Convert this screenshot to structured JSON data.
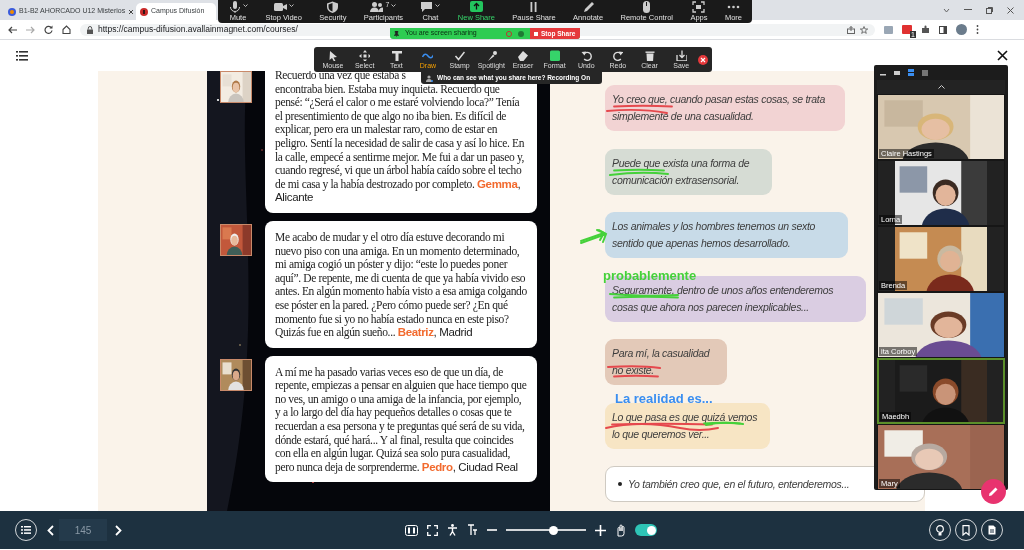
{
  "browser": {
    "tabs": [
      {
        "title": "B1-B2 AHORCADO U12 Misterios",
        "selected": false
      },
      {
        "title": "Campus Difusión",
        "selected": true
      }
    ],
    "url": "https://campus-difusion.avallainmagnet.com/courses/",
    "extension_badge": "1"
  },
  "meeting_toolbar": {
    "buttons": [
      {
        "label": "Mute",
        "kind": "mic"
      },
      {
        "label": "Stop Video",
        "kind": "video"
      },
      {
        "label": "Security",
        "kind": "shield"
      },
      {
        "label": "Participants",
        "kind": "participants",
        "count": "7"
      },
      {
        "label": "Chat",
        "kind": "chat"
      },
      {
        "label": "New Share",
        "kind": "share"
      },
      {
        "label": "Pause Share",
        "kind": "pause"
      },
      {
        "label": "Annotate",
        "kind": "annotate"
      },
      {
        "label": "Remote Control",
        "kind": "remote"
      },
      {
        "label": "Apps",
        "kind": "apps"
      },
      {
        "label": "More",
        "kind": "more"
      }
    ]
  },
  "sharing_banner": {
    "text": "You are screen sharing",
    "stop": "Stop Share"
  },
  "annotation_toolbar": {
    "tools": [
      {
        "label": "Mouse",
        "kind": "mouse",
        "selected": false
      },
      {
        "label": "Select",
        "kind": "select",
        "selected": false
      },
      {
        "label": "Text",
        "kind": "text",
        "selected": false
      },
      {
        "label": "Draw",
        "kind": "draw",
        "selected": true
      },
      {
        "label": "Stamp",
        "kind": "stamp",
        "selected": false
      },
      {
        "label": "Spotlight",
        "kind": "spotlight",
        "selected": false
      },
      {
        "label": "Eraser",
        "kind": "eraser",
        "selected": false
      },
      {
        "label": "Format",
        "kind": "format",
        "selected": false
      },
      {
        "label": "Undo",
        "kind": "undo",
        "selected": false
      },
      {
        "label": "Redo",
        "kind": "redo",
        "selected": false
      },
      {
        "label": "Clear",
        "kind": "clear",
        "selected": false
      },
      {
        "label": "Save",
        "kind": "save",
        "selected": false
      }
    ],
    "notice": "Who can see what you share here? Recording On"
  },
  "testimonials": [
    {
      "first_line": "Recuerdo una vez que estaba s",
      "text": "encontraba bien. Estaba muy inquieta. Recuerdo que pensé: “¿Será el calor o me estaré volviendo loca?” Tenía el presentimiento de que algo no iba bien. Es difícil de explicar, pero era un malestar raro, como de estar en peligro. Sentí la necesidad de salir de casa y así lo hice. En la calle, empecé a sentirme mejor. Me fui a dar un paseo y, cuando regresé, vi que un árbol había caído sobre el techo de mi casa y la había destrozado por completo.",
      "signature": "**Gemma**, Alicante"
    },
    {
      "text": "Me acabo de mudar y el otro día estuve decorando mi nuevo piso con una amiga. En un momento determinado, mi amiga cogió un póster y dijo: “este lo puedes poner aquí”. De repente, me di cuenta de que ya había vivido eso antes. En algún momento había visto a esa amiga colgando ese póster en la pared. ¿Pero cómo puede ser? ¿En qué momento fue si yo no había estado nunca en este piso? Quizás fue en algún sueño...",
      "signature": "**Beatriz**, Madrid"
    },
    {
      "text": "A mí me ha pasado varias veces eso de que un día, de repente, empiezas a pensar en alguien que hace tiempo que no ves, un amigo o una amiga de la infancia, por ejemplo, y a lo largo del día hay pequeños detalles o cosas que te recuerdan a esa persona y te preguntas qué será de su vida, dónde estará, qué hará... Y al final, resulta que coincides con ella en algún lugar. Quizá sea solo pura casualidad, pero nunca deja de sorprenderme.",
      "signature": "**Pedro**, Ciudad Real"
    }
  ],
  "opinions": [
    {
      "kind": "bubble",
      "text": "Yo creo que, cuando pasan estas cosas, se trata simplemente de una casualidad.",
      "color": "#f2d3d3"
    },
    {
      "kind": "bubble",
      "text": "Puede que exista una forma de comunicación extrasensorial.",
      "color": "#d6dcd4"
    },
    {
      "kind": "bubble",
      "text": "Los animales y los hombres tenemos un sexto sentido que apenas hemos desarrollado.",
      "color": "#c8dbe8"
    },
    {
      "kind": "bubble",
      "text": "Seguramente, dentro de unos años entenderemos cosas que ahora nos parecen inexplicables...",
      "color": "#dacde2"
    },
    {
      "kind": "bubble",
      "text": "Para mí, la casualidad no existe.",
      "color": "#e3c9b8"
    },
    {
      "kind": "bubble",
      "text": "Lo que pasa es que quizá vemos lo que queremos ver...",
      "color": "#f7e5c4"
    },
    {
      "kind": "bullet",
      "text": "Yo también creo que, en el futuro, entenderemos..."
    }
  ],
  "annotations": [
    {
      "text": "probablemente",
      "color": "#45d13a"
    },
    {
      "text": "La realidad es...",
      "color": "#3a8ef0"
    }
  ],
  "participants": [
    {
      "name": "Claire Hastings",
      "speaking": false
    },
    {
      "name": "Lorna",
      "speaking": false
    },
    {
      "name": "Brenda",
      "speaking": false
    },
    {
      "name": "ita Corboy",
      "speaking": false
    },
    {
      "name": "Maedbh",
      "speaking": true
    },
    {
      "name": "Mary",
      "speaking": false
    }
  ],
  "reader_bar": {
    "page": "145",
    "zoom": {
      "level": 0.6
    },
    "toggle_on": true
  }
}
